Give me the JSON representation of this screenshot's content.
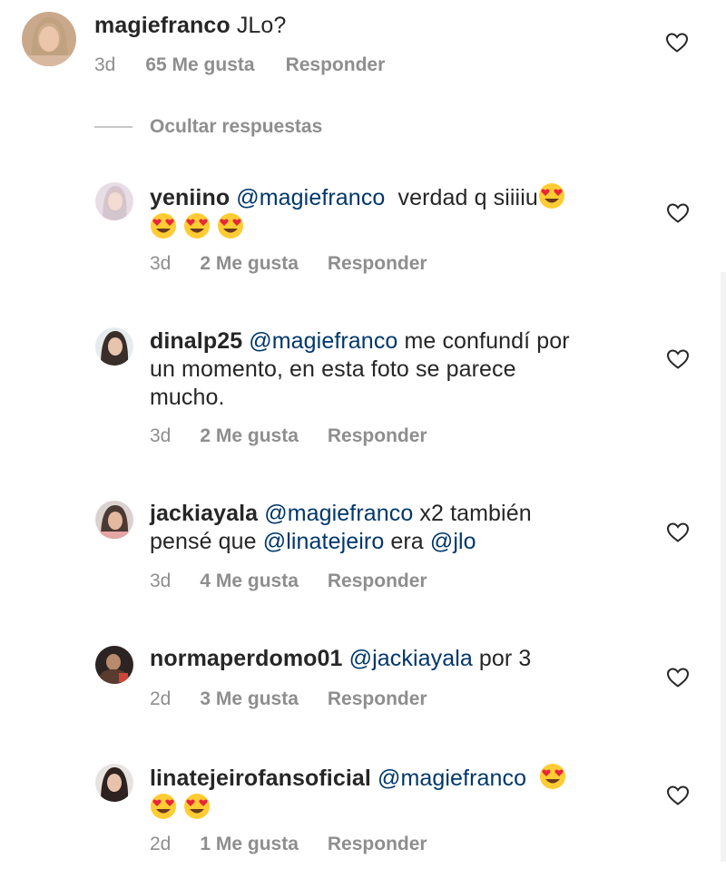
{
  "comments": [
    {
      "username": "magiefranco",
      "text": "JLo?",
      "time": "3d",
      "likes": "65 Me gusta",
      "reply": "Responder"
    },
    {
      "username": "yeniino",
      "mention": "@magiefranco",
      "text": "verdad q siiiiu",
      "emoji_count": 4,
      "time": "3d",
      "likes": "2 Me gusta",
      "reply": "Responder"
    },
    {
      "username": "dinalp25",
      "mention": "@magiefranco",
      "text_line1": "me confundí por",
      "text_line2": "un momento, en esta foto se parece",
      "text_line3": "mucho.",
      "time": "3d",
      "likes": "2 Me gusta",
      "reply": "Responder"
    },
    {
      "username": "jackiayala",
      "mention": "@magiefranco",
      "text_a": "x2 también",
      "text_b": "pensé que",
      "mention2": "@linatejeiro",
      "text_c": "era",
      "mention3": "@jlo",
      "time": "3d",
      "likes": "4 Me gusta",
      "reply": "Responder"
    },
    {
      "username": "normaperdomo01",
      "mention": "@jackiayala",
      "text": "por 3",
      "time": "2d",
      "likes": "3 Me gusta",
      "reply": "Responder"
    },
    {
      "username": "linatejeirofansoficial",
      "mention": "@magiefranco",
      "emoji_count": 3,
      "time": "2d",
      "likes": "1 Me gusta",
      "reply": "Responder"
    }
  ],
  "hide_replies_label": "Ocultar respuestas",
  "icons": {
    "like": "heart-outline-icon",
    "emoji": "heart-eyes-emoji"
  },
  "colors": {
    "text": "#262626",
    "meta": "#8e8e8e",
    "mention": "#00376b",
    "heart_stroke": "#262626"
  }
}
